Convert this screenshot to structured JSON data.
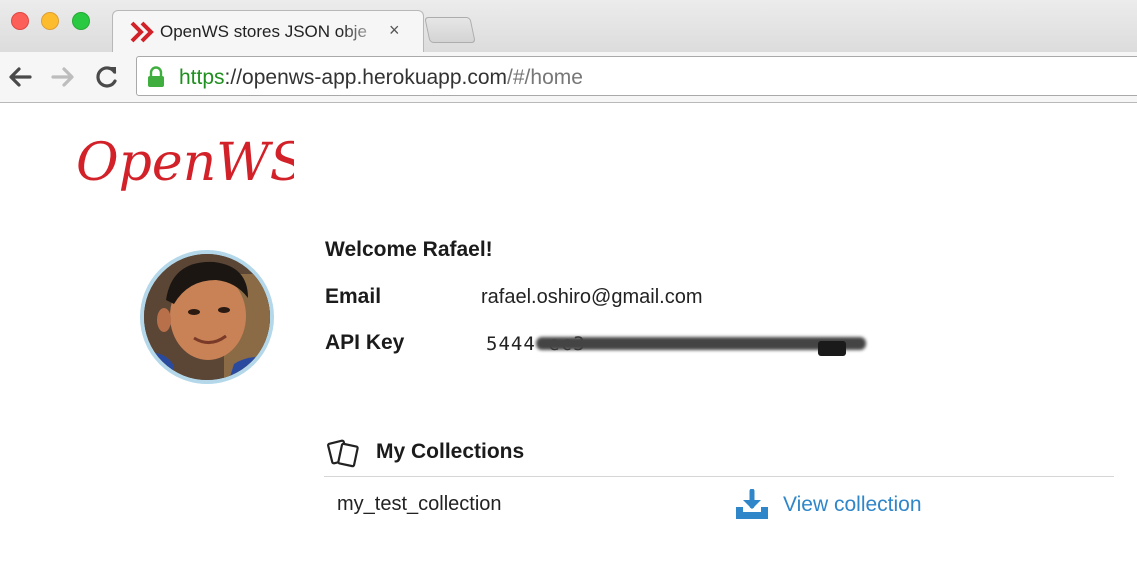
{
  "window": {
    "tab_title": "OpenWS stores JSON obje",
    "tab_close": "×"
  },
  "toolbar": {
    "url_scheme": "https",
    "url_host": "://openws-app.herokuapp.com",
    "url_path": "/#/home"
  },
  "header": {
    "logo_text": "OpenWS"
  },
  "profile": {
    "welcome": "Welcome Rafael!",
    "email_label": "Email",
    "email_value": "rafael.oshiro@gmail.com",
    "api_label": "API Key",
    "api_value": "5444                                    ec3"
  },
  "collections": {
    "title": "My Collections",
    "items": [
      {
        "name": "my_test_collection",
        "action_label": "View collection"
      }
    ]
  },
  "colors": {
    "brand_red": "#d22128",
    "link_blue": "#2f86c9",
    "secure_green": "#1f8f1f",
    "avatar_ring": "#b4d8ea"
  },
  "icons": {
    "tab": "openws-favicon-icon",
    "lock": "lock-icon",
    "back": "back-arrow-icon",
    "forward": "forward-arrow-icon",
    "reload": "reload-icon",
    "collections": "cards-icon",
    "download": "download-icon"
  }
}
